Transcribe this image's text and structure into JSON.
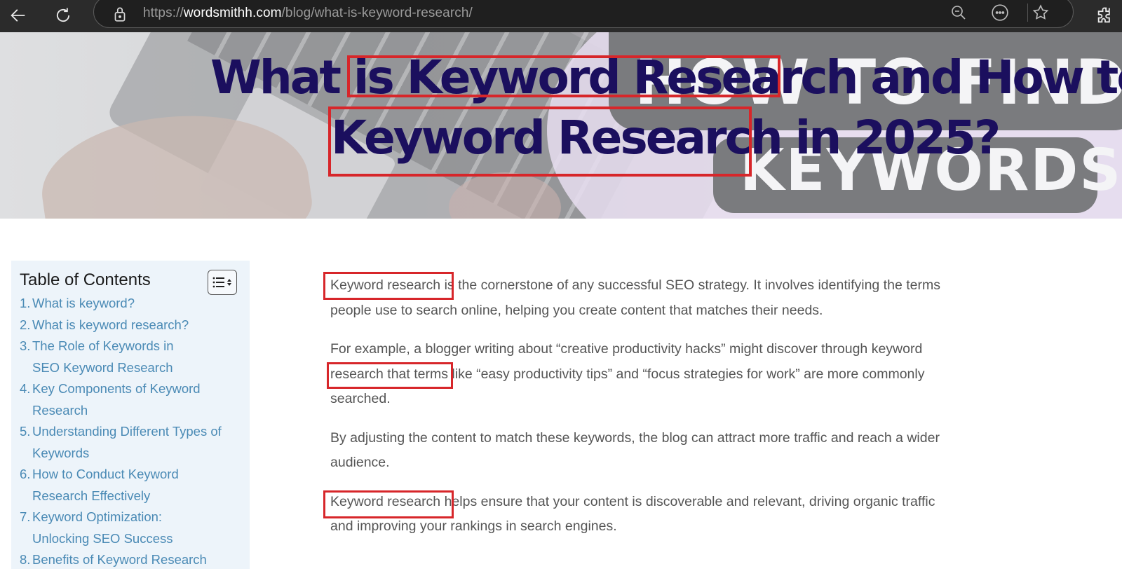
{
  "browser": {
    "back_icon": "arrow-left-icon",
    "reload_icon": "reload-icon",
    "url_scheme": "https://",
    "url_domain": "wordsmithh.com",
    "url_path": "/blog/what-is-keyword-research/",
    "toolbar_icons": [
      "zoom-out-icon",
      "more-icon",
      "star-icon",
      "extensions-icon"
    ]
  },
  "hero": {
    "title_line1_pre": "What is ",
    "title_line1_highlight": "Keyword Research",
    "title_line1_post": " and How to Do",
    "title_line2_highlight": "Keyword Research",
    "title_line2_post": " in 2025?",
    "background_text_1": "HOW TO FIND BEST",
    "background_text_2": "KEYWORDS",
    "title_color": "#1b0f5e",
    "highlight_color": "#d7262a"
  },
  "toc": {
    "title": "Table of Contents",
    "toggle_icon": "list-toggle-icon",
    "items": [
      {
        "num": "1.",
        "label": "What is keyword?"
      },
      {
        "num": "2.",
        "label": "What is keyword research?"
      },
      {
        "num": "3.",
        "label": "The Role of Keywords in SEO Keyword Research"
      },
      {
        "num": "4.",
        "label": "Key Components of Keyword Research"
      },
      {
        "num": "5.",
        "label": "Understanding Different Types of Keywords"
      },
      {
        "num": "6.",
        "label": "How to Conduct Keyword Research Effectively"
      },
      {
        "num": "7.",
        "label": "Keyword Optimization: Unlocking SEO Success"
      },
      {
        "num": "8.",
        "label": "Benefits of Keyword Research"
      }
    ],
    "link_color": "#4a8ab5"
  },
  "article": {
    "paragraphs": [
      {
        "highlight": "Keyword research",
        "rest": " is the cornerstone of any successful SEO strategy. It involves identifying the terms people use to search online, helping you create content that matches their needs."
      },
      {
        "pre": "For example, a blogger writing about “creative productivity hacks” might discover through ",
        "highlight": "keyword research",
        "rest": " that terms like “easy productivity tips” and “focus strategies for work” are more commonly searched."
      },
      {
        "text": "By adjusting the content to match these keywords, the blog can attract more traffic and reach a wider audience."
      },
      {
        "highlight": "Keyword research",
        "rest": " helps ensure that your content is discoverable and relevant, driving organic traffic and improving your rankings in search engines."
      }
    ]
  }
}
